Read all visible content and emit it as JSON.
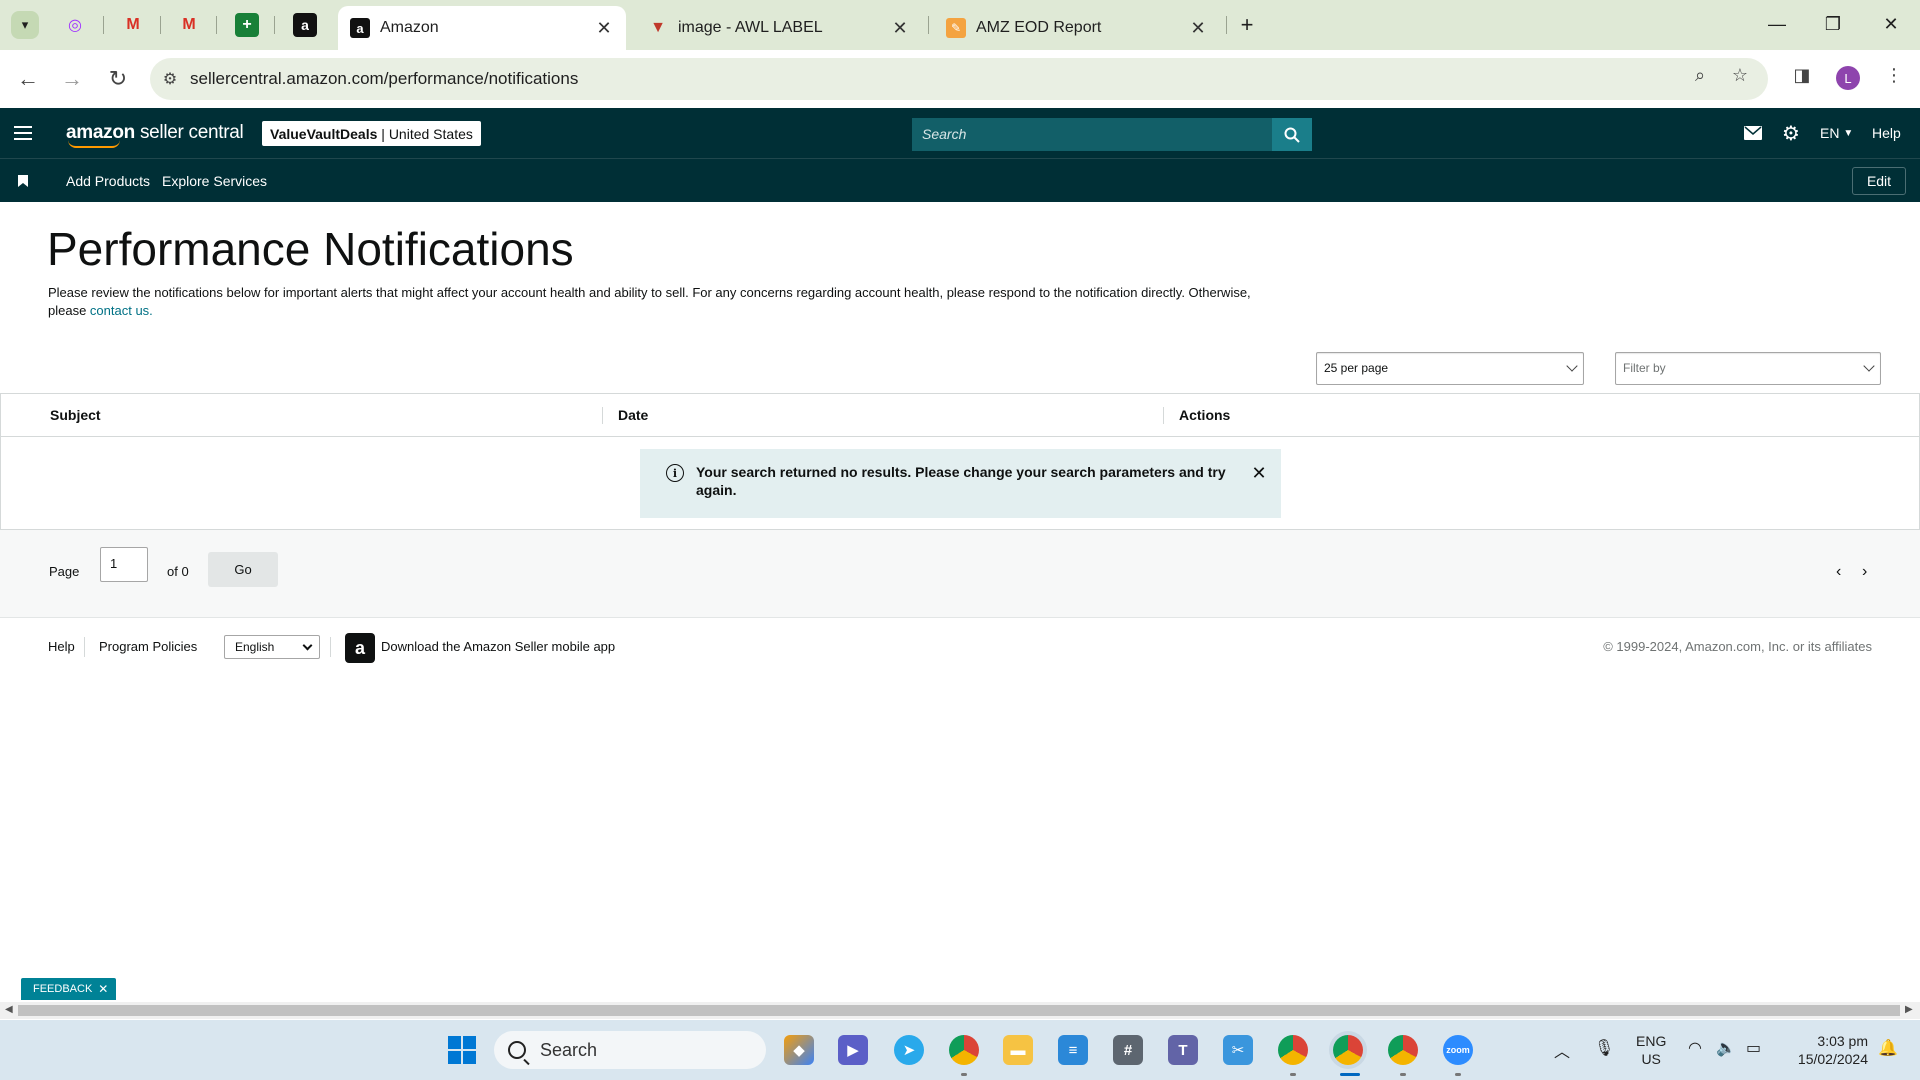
{
  "browser": {
    "tabs": [
      {
        "title": "Amazon",
        "active": true
      },
      {
        "title": "image - AWL LABEL",
        "active": false
      },
      {
        "title": "AMZ EOD Report",
        "active": false
      }
    ],
    "url": "sellercentral.amazon.com/performance/notifications",
    "profile_initial": "L"
  },
  "header": {
    "logo_amazon": "amazon",
    "logo_rest": "seller central",
    "store_name": "ValueVaultDeals",
    "store_region": "| United States",
    "search_placeholder": "Search",
    "language": "EN",
    "help": "Help",
    "nav": [
      "Add Products",
      "Explore Services"
    ],
    "edit_label": "Edit"
  },
  "main": {
    "title": "Performance Notifications",
    "intro_text": "Please review the notifications below for important alerts that might affect your account health and ability to sell. For any concerns regarding account health, please respond to the notification directly. Otherwise, please ",
    "intro_link": "contact us.",
    "per_page": "25 per page",
    "filter_placeholder": "Filter by",
    "columns": [
      "Subject",
      "Date",
      "Actions"
    ],
    "alert_message": "Your search returned no results. Please change your search parameters and try again.",
    "pagination": {
      "page_label": "Page",
      "page_value": "1",
      "of_label": "of 0",
      "go_label": "Go"
    }
  },
  "footer": {
    "links": [
      "Help",
      "Program Policies"
    ],
    "language_select": "English",
    "app_text": "Download the Amazon Seller mobile app",
    "copyright": "© 1999-2024, Amazon.com, Inc. or its affiliates"
  },
  "feedback": {
    "label": "FEEDBACK"
  },
  "taskbar": {
    "search_label": "Search",
    "lang_1": "ENG",
    "lang_2": "US",
    "time": "3:03 pm",
    "date": "15/02/2024"
  },
  "colors": {
    "header_bg": "#002f36",
    "search_btn": "#1a7e8a",
    "link": "#007185",
    "alert_bg": "#e3eff0"
  }
}
